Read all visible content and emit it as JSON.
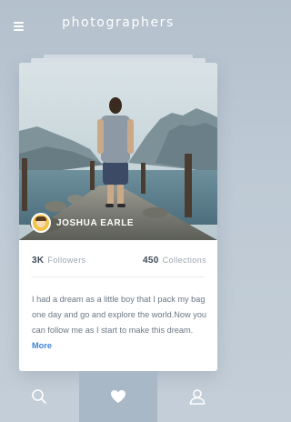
{
  "header": {
    "title": "photographers",
    "menu_icon": "hamburger-menu-icon"
  },
  "card": {
    "photo_description_icon": "landscape-photo",
    "user": {
      "name": "JOSHUA EARLE",
      "avatar_icon": "avatar-icon"
    },
    "stats": {
      "followers_value": "3K",
      "followers_label": "Followers",
      "collections_value": "450",
      "collections_label": "Collections"
    },
    "bio": {
      "text": "I had a dream as a little boy that I pack my bag one day and go and explore the world.Now you can follow me as I start to make this dream.",
      "more_link": "More"
    }
  },
  "tabbar": {
    "items": [
      {
        "icon": "search-icon",
        "active": false
      },
      {
        "icon": "heart-icon",
        "active": true
      },
      {
        "icon": "user-icon",
        "active": false
      }
    ]
  },
  "colors": {
    "background": "#bcc8d3",
    "active_tab": "#a9b8c6",
    "link": "#3d82d6",
    "text_dark": "#3f4a57",
    "text_muted": "#9aa5b1"
  }
}
